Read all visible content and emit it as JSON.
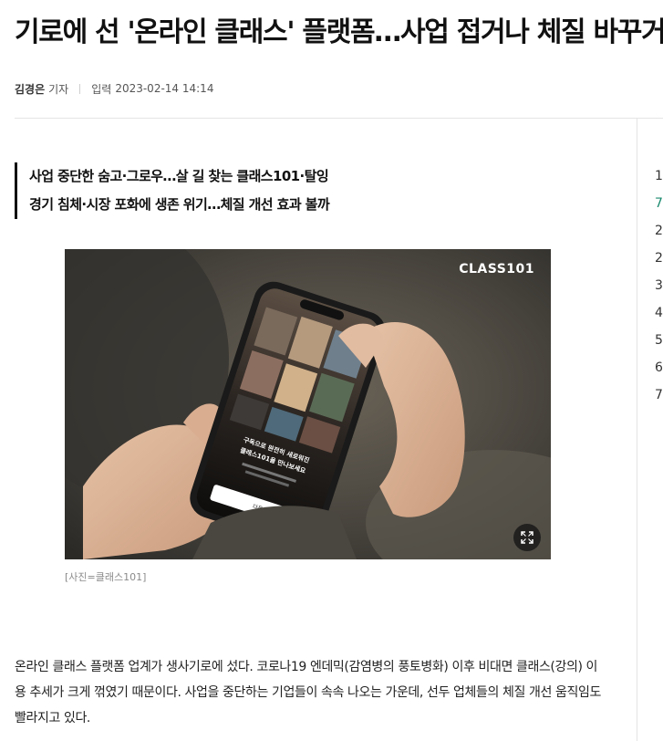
{
  "article": {
    "headline": "기로에 선 '온라인 클래스' 플랫폼…사업 접거나 체질 바꾸거나",
    "reporter_name": "김경은",
    "reporter_role": "기자",
    "published_label": "입력",
    "published_at": "2023-02-14 14:14",
    "subheads": [
      "사업 중단한 숨고·그로우…살 길 찾는 클래스101·탈잉",
      "경기 침체·시장 포화에 생존 위기…체질 개선 효과 볼까"
    ],
    "photo": {
      "brand_text": "CLASS101",
      "phone_text_line1": "구독으로 완전히 새로워진",
      "phone_text_line2": "클래스101을 만나보세요",
      "phone_button": "다음",
      "caption": "[사진=클래스101]",
      "expand_icon": "expand-icon"
    },
    "paragraph": "온라인 클래스 플랫폼 업계가 생사기로에 섰다. 코로나19 엔데믹(감염병의 풍토병화) 이후 비대면 클래스(강의) 이용 추세가 크게 꺾였기 때문이다. 사업을 중단하는 기업들이 속속 나오는 가운데, 선두 업체들의 체질 개선 움직임도 빨라지고 있다."
  },
  "sidebar_peek": [
    "1",
    "7",
    "2",
    "2",
    "3",
    "4",
    "5",
    "6",
    "7"
  ],
  "colors": {
    "accent": "#1a8a6e",
    "rule": "#e4e4e4",
    "caption": "#8a8a8a"
  }
}
